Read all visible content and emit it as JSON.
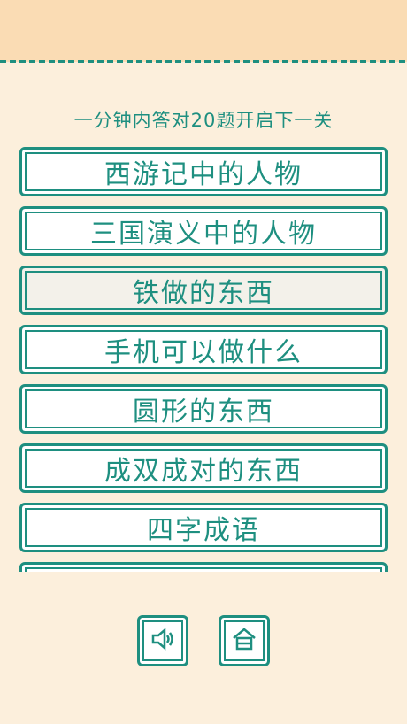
{
  "header": {
    "subtitle": "一分钟内答对20题开启下一关"
  },
  "categories": [
    {
      "label": "西游记中的人物",
      "selected": false
    },
    {
      "label": "三国演义中的人物",
      "selected": false
    },
    {
      "label": "铁做的东西",
      "selected": true
    },
    {
      "label": "手机可以做什么",
      "selected": false
    },
    {
      "label": "圆形的东西",
      "selected": false
    },
    {
      "label": "成双成对的东西",
      "selected": false
    },
    {
      "label": "四字成语",
      "selected": false
    }
  ],
  "controls": {
    "sound_icon": "speaker-icon",
    "home_icon": "home-icon"
  },
  "colors": {
    "background": "#fcefdc",
    "topbar": "#fadcb4",
    "accent": "#1e8f80",
    "button_fill": "#ffffff",
    "selected_fill": "#f3f1ea"
  }
}
